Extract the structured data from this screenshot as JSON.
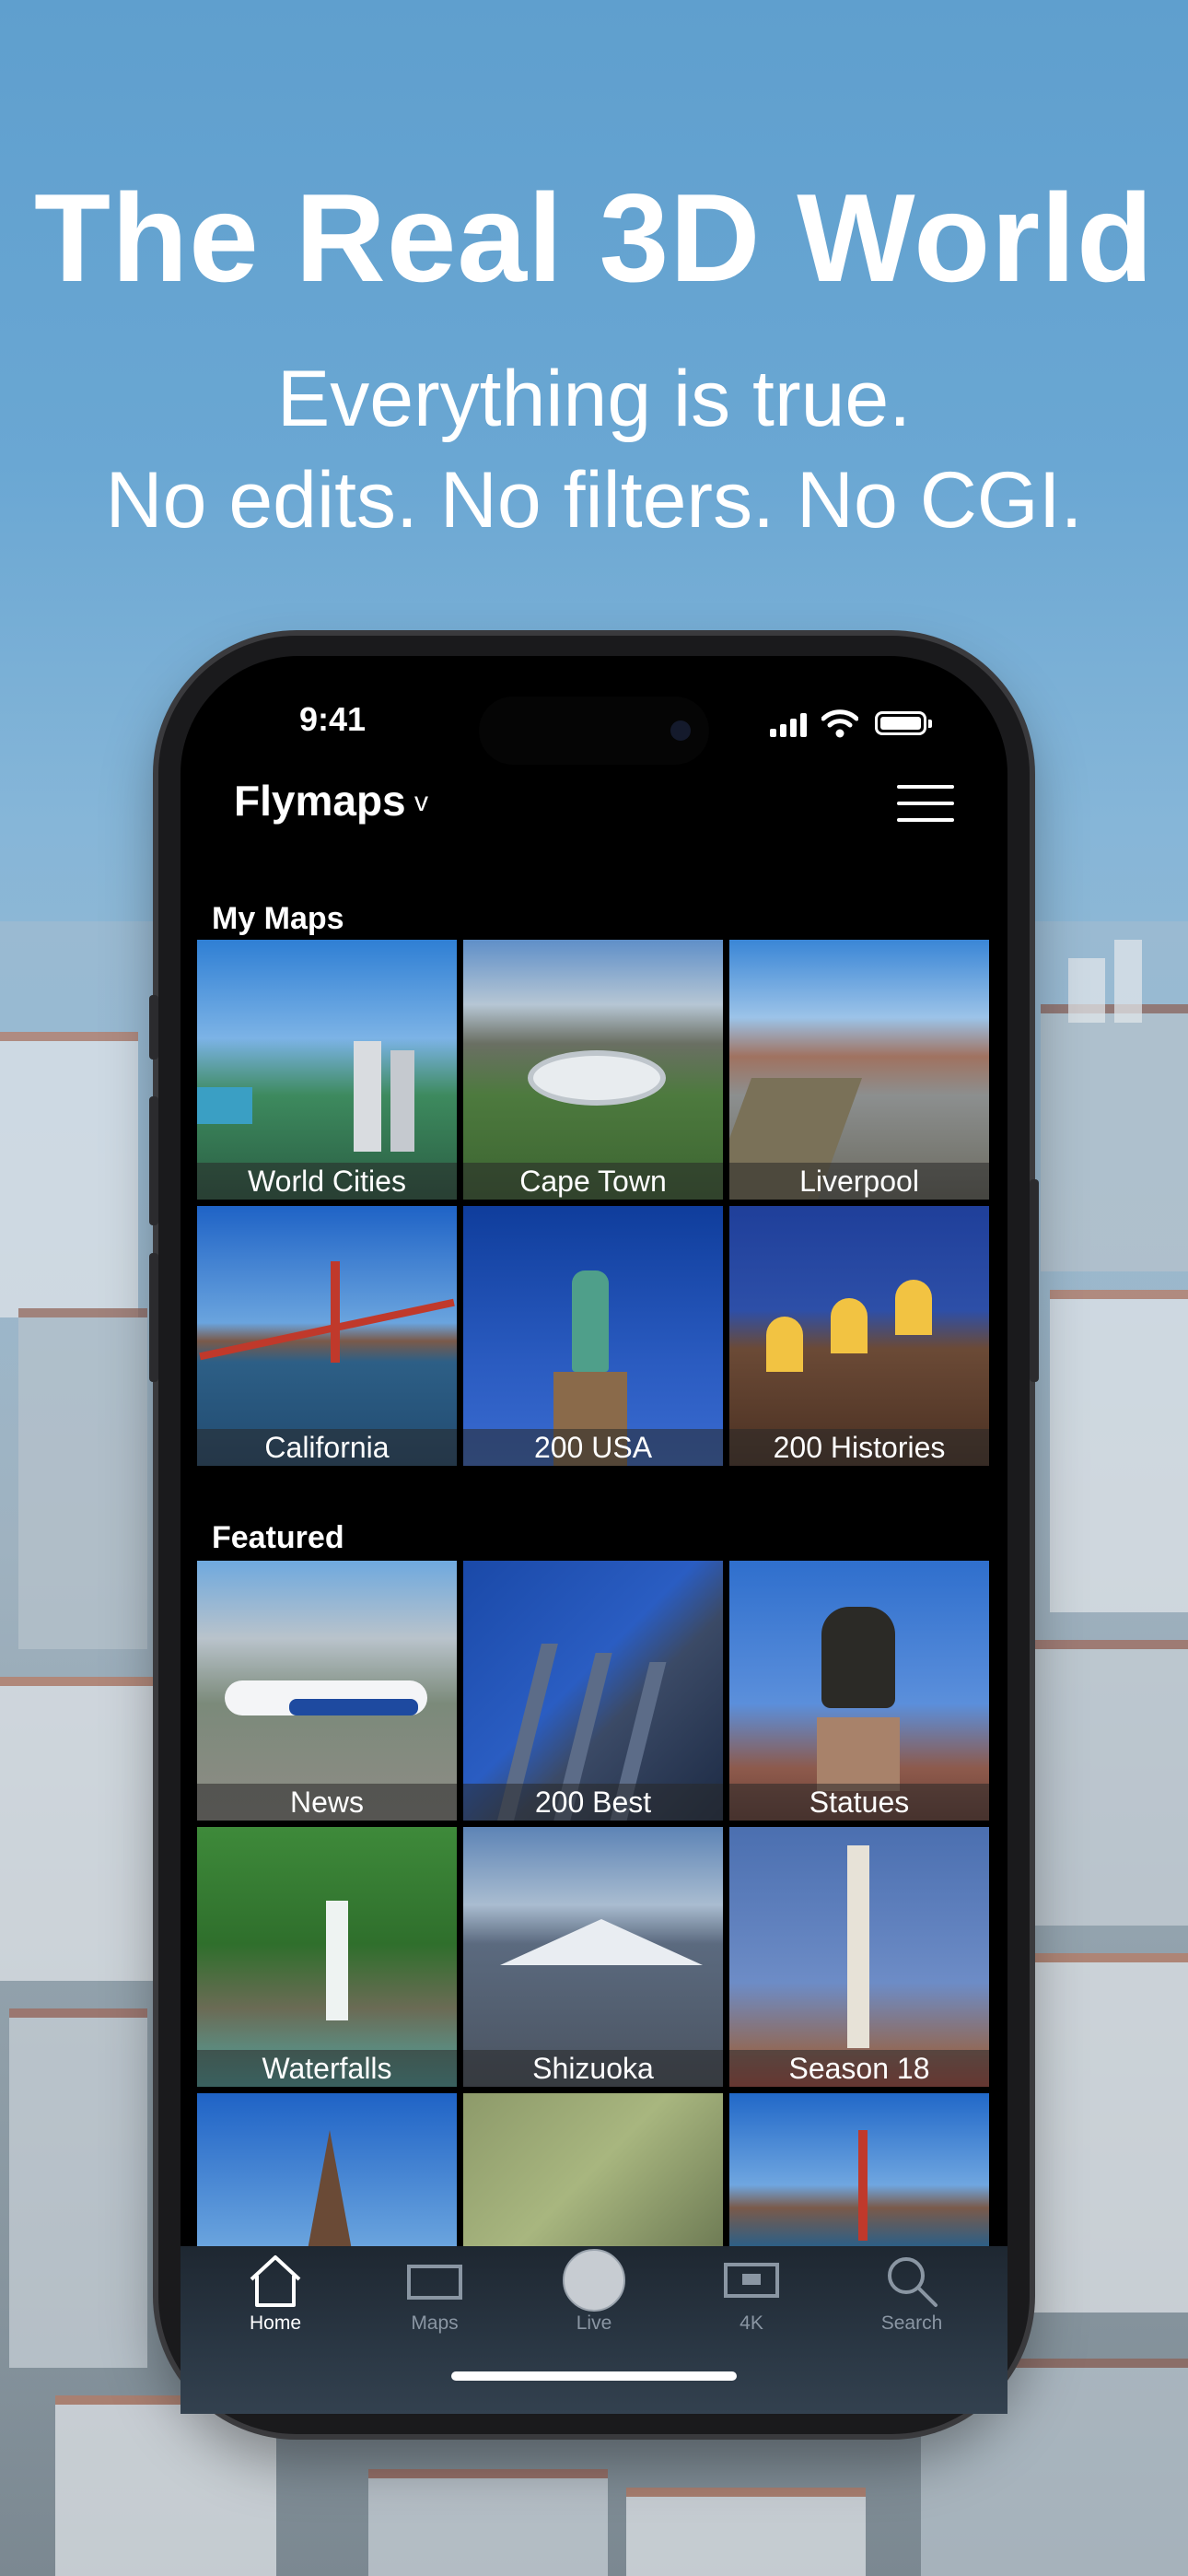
{
  "hero": {
    "headline": "The Real 3D World",
    "subline_1": "Everything is true.",
    "subline_2": "No edits. No filters. No CGI."
  },
  "status_bar": {
    "time": "9:41"
  },
  "header": {
    "app_title": "Flymaps",
    "chevron": "v"
  },
  "sections": {
    "my_maps": {
      "label": "My Maps",
      "tiles": [
        "World Cities",
        "Cape Town",
        "Liverpool",
        "California",
        "200 USA",
        "200 Histories"
      ]
    },
    "featured": {
      "label": "Featured",
      "tiles": [
        "News",
        "200 Best",
        "Statues",
        "Waterfalls",
        "Shizuoka",
        "Season 18"
      ]
    }
  },
  "tab_bar": {
    "items": [
      {
        "label": "Home",
        "icon": "house-icon",
        "active": true
      },
      {
        "label": "Maps",
        "icon": "rectangle-icon",
        "active": false
      },
      {
        "label": "Live",
        "icon": "circle-icon",
        "active": false
      },
      {
        "label": "4K",
        "icon": "screen-icon",
        "active": false
      },
      {
        "label": "Search",
        "icon": "search-icon",
        "active": false
      }
    ]
  },
  "colors": {
    "sky_blue": "#5f9fce",
    "screen_bg": "#000000",
    "tab_active": "#ffffff",
    "tab_inactive": "#8a96a3"
  }
}
